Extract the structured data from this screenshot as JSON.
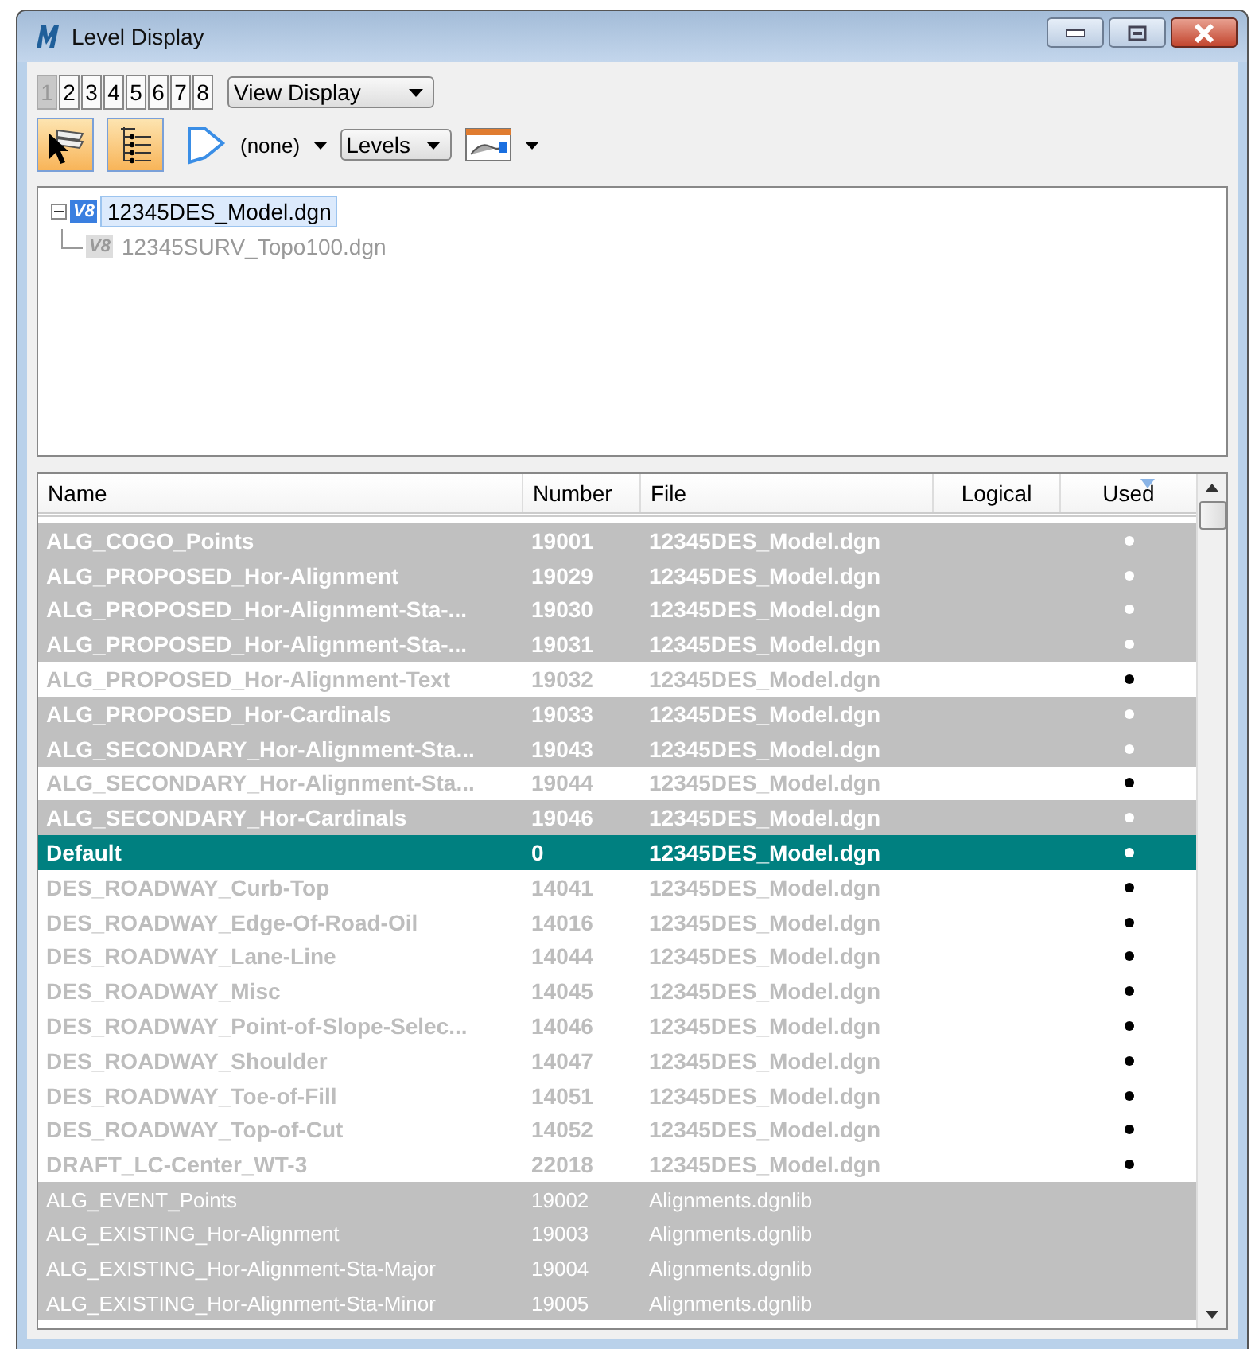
{
  "window": {
    "title": "Level Display"
  },
  "view_tabs": [
    {
      "label": "1",
      "selected": true
    },
    {
      "label": "2",
      "selected": false
    },
    {
      "label": "3",
      "selected": false
    },
    {
      "label": "4",
      "selected": false
    },
    {
      "label": "5",
      "selected": false
    },
    {
      "label": "6",
      "selected": false
    },
    {
      "label": "7",
      "selected": false
    },
    {
      "label": "8",
      "selected": false
    }
  ],
  "view_dropdown": {
    "value": "View Display"
  },
  "toolbar": {
    "levels_toggle": {
      "on": true
    },
    "tree_toggle": {
      "on": true
    },
    "filter_value": "(none)",
    "mode_dropdown": "Levels"
  },
  "tree": [
    {
      "label": "12345DES_Model.dgn",
      "badge": "V8",
      "selected": true,
      "disabled": false,
      "expanded": true,
      "children": [
        {
          "label": "12345SURV_Topo100.dgn",
          "badge": "V8",
          "selected": false,
          "disabled": true
        }
      ]
    }
  ],
  "table": {
    "columns": [
      "Name",
      "Number",
      "File",
      "Logical",
      "Used"
    ],
    "rows": [
      {
        "name": "ALG_COGO_Points",
        "number": "19001",
        "file": "12345DES_Model.dgn",
        "kind": "model",
        "used": true,
        "selected": true,
        "active": false
      },
      {
        "name": "ALG_PROPOSED_Hor-Alignment",
        "number": "19029",
        "file": "12345DES_Model.dgn",
        "kind": "model",
        "used": true,
        "selected": true,
        "active": false
      },
      {
        "name": "ALG_PROPOSED_Hor-Alignment-Sta-...",
        "number": "19030",
        "file": "12345DES_Model.dgn",
        "kind": "model",
        "used": true,
        "selected": true,
        "active": false
      },
      {
        "name": "ALG_PROPOSED_Hor-Alignment-Sta-...",
        "number": "19031",
        "file": "12345DES_Model.dgn",
        "kind": "model",
        "used": true,
        "selected": true,
        "active": false
      },
      {
        "name": "ALG_PROPOSED_Hor-Alignment-Text",
        "number": "19032",
        "file": "12345DES_Model.dgn",
        "kind": "model",
        "used": true,
        "selected": false,
        "active": false
      },
      {
        "name": "ALG_PROPOSED_Hor-Cardinals",
        "number": "19033",
        "file": "12345DES_Model.dgn",
        "kind": "model",
        "used": true,
        "selected": true,
        "active": false
      },
      {
        "name": "ALG_SECONDARY_Hor-Alignment-Sta...",
        "number": "19043",
        "file": "12345DES_Model.dgn",
        "kind": "model",
        "used": true,
        "selected": true,
        "active": false
      },
      {
        "name": "ALG_SECONDARY_Hor-Alignment-Sta...",
        "number": "19044",
        "file": "12345DES_Model.dgn",
        "kind": "model",
        "used": true,
        "selected": false,
        "active": false
      },
      {
        "name": "ALG_SECONDARY_Hor-Cardinals",
        "number": "19046",
        "file": "12345DES_Model.dgn",
        "kind": "model",
        "used": true,
        "selected": true,
        "active": false
      },
      {
        "name": "Default",
        "number": "0",
        "file": "12345DES_Model.dgn",
        "kind": "model",
        "used": true,
        "selected": false,
        "active": true
      },
      {
        "name": "DES_ROADWAY_Curb-Top",
        "number": "14041",
        "file": "12345DES_Model.dgn",
        "kind": "model",
        "used": true,
        "selected": false,
        "active": false
      },
      {
        "name": "DES_ROADWAY_Edge-Of-Road-Oil",
        "number": "14016",
        "file": "12345DES_Model.dgn",
        "kind": "model",
        "used": true,
        "selected": false,
        "active": false
      },
      {
        "name": "DES_ROADWAY_Lane-Line",
        "number": "14044",
        "file": "12345DES_Model.dgn",
        "kind": "model",
        "used": true,
        "selected": false,
        "active": false
      },
      {
        "name": "DES_ROADWAY_Misc",
        "number": "14045",
        "file": "12345DES_Model.dgn",
        "kind": "model",
        "used": true,
        "selected": false,
        "active": false
      },
      {
        "name": "DES_ROADWAY_Point-of-Slope-Selec...",
        "number": "14046",
        "file": "12345DES_Model.dgn",
        "kind": "model",
        "used": true,
        "selected": false,
        "active": false
      },
      {
        "name": "DES_ROADWAY_Shoulder",
        "number": "14047",
        "file": "12345DES_Model.dgn",
        "kind": "model",
        "used": true,
        "selected": false,
        "active": false
      },
      {
        "name": "DES_ROADWAY_Toe-of-Fill",
        "number": "14051",
        "file": "12345DES_Model.dgn",
        "kind": "model",
        "used": true,
        "selected": false,
        "active": false
      },
      {
        "name": "DES_ROADWAY_Top-of-Cut",
        "number": "14052",
        "file": "12345DES_Model.dgn",
        "kind": "model",
        "used": true,
        "selected": false,
        "active": false
      },
      {
        "name": "DRAFT_LC-Center_WT-3",
        "number": "22018",
        "file": "12345DES_Model.dgn",
        "kind": "model",
        "used": true,
        "selected": false,
        "active": false
      },
      {
        "name": "ALG_EVENT_Points",
        "number": "19002",
        "file": "Alignments.dgnlib",
        "kind": "library",
        "used": false,
        "selected": true,
        "active": false
      },
      {
        "name": "ALG_EXISTING_Hor-Alignment",
        "number": "19003",
        "file": "Alignments.dgnlib",
        "kind": "library",
        "used": false,
        "selected": true,
        "active": false
      },
      {
        "name": "ALG_EXISTING_Hor-Alignment-Sta-Major",
        "number": "19004",
        "file": "Alignments.dgnlib",
        "kind": "library",
        "used": false,
        "selected": true,
        "active": false
      },
      {
        "name": "ALG_EXISTING_Hor-Alignment-Sta-Minor",
        "number": "19005",
        "file": "Alignments.dgnlib",
        "kind": "library",
        "used": false,
        "selected": true,
        "active": false
      }
    ]
  }
}
